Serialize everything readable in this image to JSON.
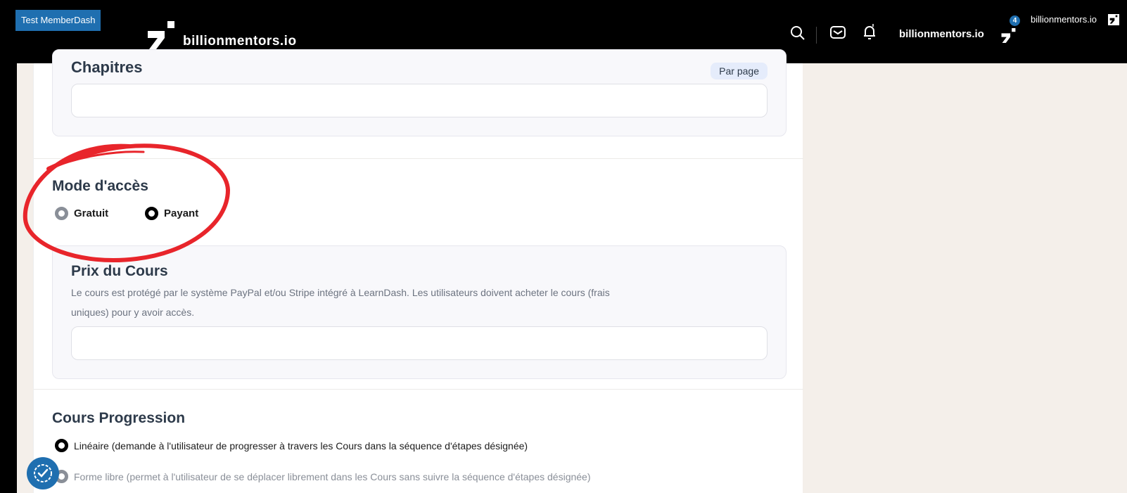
{
  "header": {
    "tag": "Test MemberDash",
    "logo_text": "billionmentors.io",
    "site_link": "billionmentors.io",
    "badge_count": "4",
    "user_name": "billionmentors.io",
    "icons": [
      "search-icon",
      "mail-icon",
      "bell-icon"
    ]
  },
  "chapitres": {
    "title": "Chapitres",
    "pill": "Par page",
    "input_value": ""
  },
  "access_mode": {
    "title": "Mode d'accès",
    "options": [
      {
        "label": "Gratuit",
        "selected": false
      },
      {
        "label": "Payant",
        "selected": true
      }
    ]
  },
  "course_price": {
    "title": "Prix du Cours",
    "help_line1": "Le cours est protégé par le système PayPal et/ou Stripe intégré à LearnDash. Les utilisateurs doivent acheter le cours (frais",
    "help_line2": "uniques) pour y avoir accès.",
    "input_value": ""
  },
  "progression": {
    "title": "Cours Progression",
    "options": [
      {
        "label": "Linéaire (demande à l'utilisateur de progresser à travers les Cours dans la séquence d'étapes désignée)",
        "selected": true
      },
      {
        "label": "Forme libre (permet à l'utilisateur de se déplacer librement dans les Cours sans suivre la séquence d'étapes désignée)",
        "selected": false
      }
    ]
  },
  "colors": {
    "accent": "#1f6fb0",
    "annotation": "#e8252b"
  }
}
